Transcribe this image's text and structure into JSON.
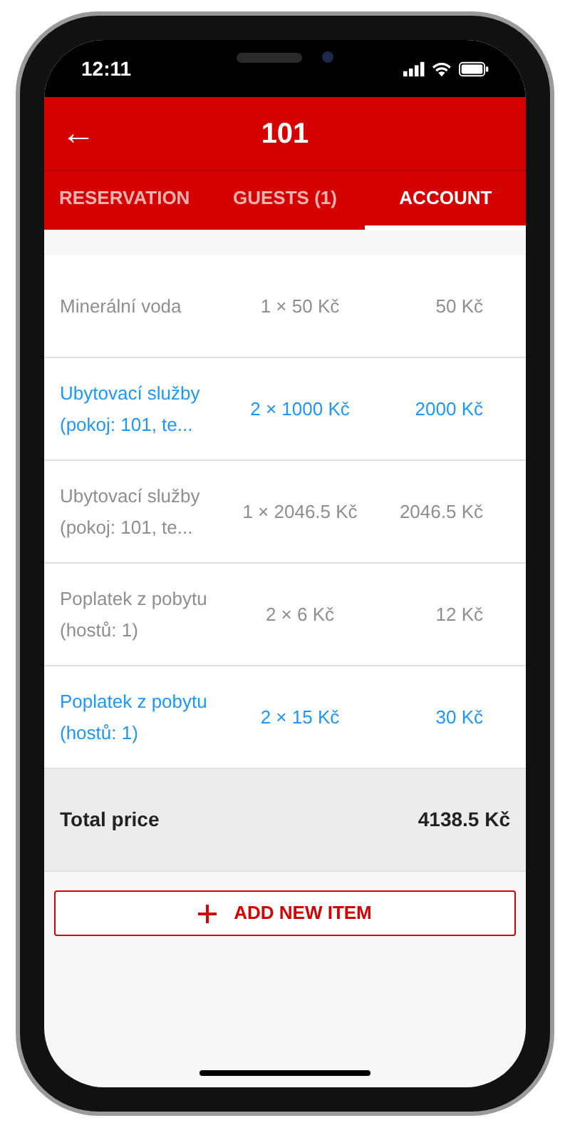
{
  "status_bar": {
    "time": "12:11"
  },
  "header": {
    "back_icon": "←",
    "title": "101"
  },
  "tabs": [
    {
      "label": "RESERVATION",
      "selected": false
    },
    {
      "label": "GUESTS (1)",
      "selected": false
    },
    {
      "label": "ACCOUNT",
      "selected": true
    }
  ],
  "items": [
    {
      "name": "Minerální voda",
      "quantity": "1 × 50 Kč",
      "price": "50 Kč",
      "highlighted": false
    },
    {
      "name": "Ubytovací služby (pokoj: 101, te...",
      "quantity": "2 × 1000 Kč",
      "price": "2000 Kč",
      "highlighted": true
    },
    {
      "name": "Ubytovací služby (pokoj: 101, te...",
      "quantity": "1 × 2046.5 Kč",
      "price": "2046.5 Kč",
      "highlighted": false
    },
    {
      "name": "Poplatek z pobytu (hostů: 1)",
      "quantity": "2 × 6 Kč",
      "price": "12 Kč",
      "highlighted": false
    },
    {
      "name": "Poplatek z pobytu (hostů: 1)",
      "quantity": "2 × 15 Kč",
      "price": "30 Kč",
      "highlighted": true
    }
  ],
  "total": {
    "label": "Total price",
    "value": "4138.5 Kč"
  },
  "add_button": {
    "label": "ADD NEW ITEM"
  }
}
